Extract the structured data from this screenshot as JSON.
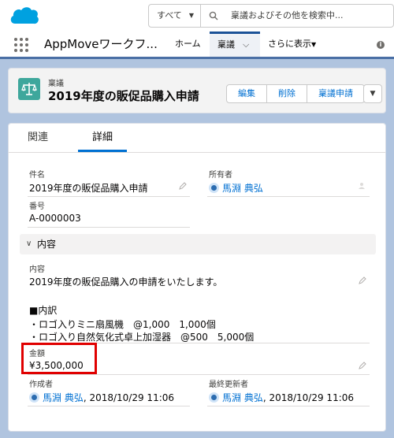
{
  "header": {
    "search_scope": "すべて",
    "search_placeholder": "稟議およびその他を検索中..."
  },
  "nav": {
    "app_name": "AppMoveワークフ...",
    "items": [
      {
        "label": "ホーム"
      },
      {
        "label": "稟議"
      },
      {
        "label": "さらに表示"
      }
    ]
  },
  "record": {
    "type": "稟議",
    "title": "2019年度の販促品購入申請",
    "actions": [
      "編集",
      "削除",
      "稟議申請"
    ]
  },
  "tabs": [
    "関連",
    "詳細"
  ],
  "fields": {
    "name_label": "件名",
    "name_value": "2019年度の販促品購入申請",
    "owner_label": "所有者",
    "owner_value": "馬淵 典弘",
    "number_label": "番号",
    "number_value": "A-0000003",
    "section_title": "内容",
    "content_label": "内容",
    "content_lines": [
      "2019年度の販促品購入の申請をいたします。",
      "",
      "■内訳",
      "・ロゴ入りミニ扇風機　@1,000　1,000個",
      "・ロゴ入り自然気化式卓上加湿器　@500　5,000個"
    ],
    "amount_label": "金額",
    "amount_value": "¥3,500,000",
    "created_label": "作成者",
    "created_user": "馬淵 典弘",
    "created_date": ", 2018/10/29 11:06",
    "modified_label": "最終更新者",
    "modified_user": "馬淵 典弘",
    "modified_date": ", 2018/10/29 11:06"
  },
  "colors": {
    "brand_blue": "#00a1e0",
    "link": "#0070d2",
    "record_icon": "#3ea79c",
    "highlight": "#e00000"
  }
}
